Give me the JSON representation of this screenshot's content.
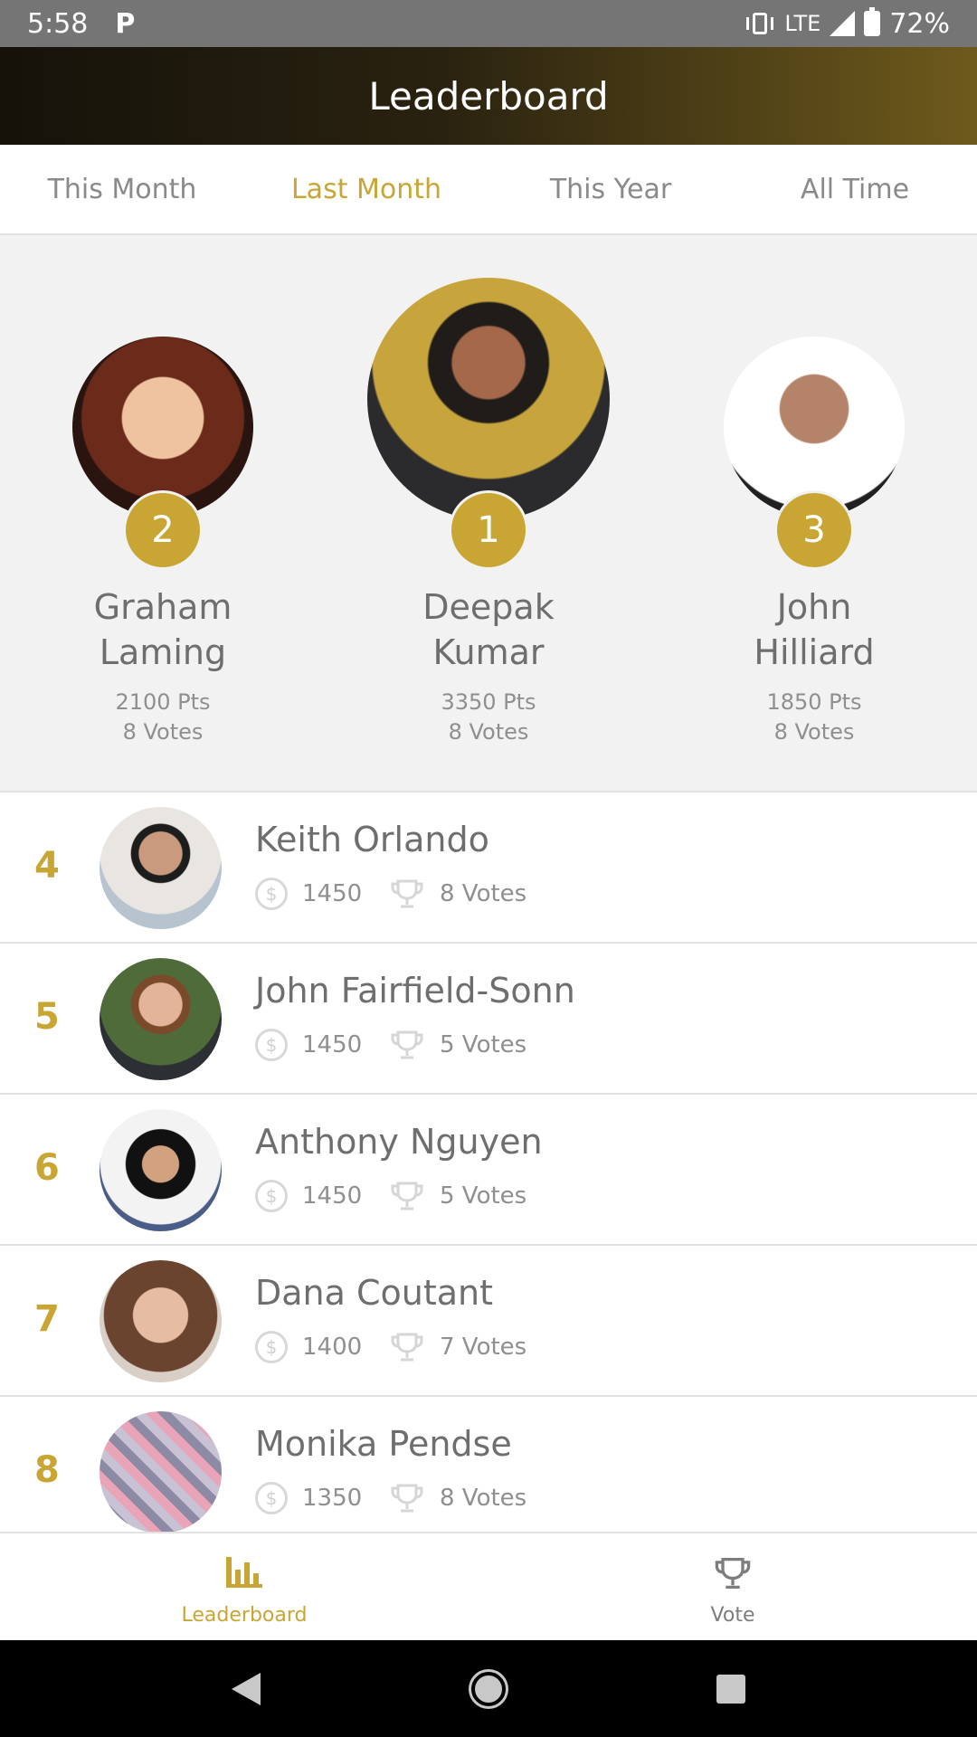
{
  "status_bar": {
    "time": "5:58",
    "network": "LTE",
    "battery": "72%"
  },
  "header": {
    "title": "Leaderboard"
  },
  "tabs": [
    {
      "label": "This Month",
      "active": false
    },
    {
      "label": "Last Month",
      "active": true
    },
    {
      "label": "This Year",
      "active": false
    },
    {
      "label": "All Time",
      "active": false
    }
  ],
  "podium": {
    "second": {
      "rank": "2",
      "first": "Graham",
      "last": "Laming",
      "points": "2100 Pts",
      "votes": "8 Votes"
    },
    "first": {
      "rank": "1",
      "first": "Deepak",
      "last": "Kumar",
      "points": "3350 Pts",
      "votes": "8 Votes"
    },
    "third": {
      "rank": "3",
      "first": "John",
      "last": "Hilliard",
      "points": "1850 Pts",
      "votes": "8 Votes"
    }
  },
  "list": [
    {
      "rank": "4",
      "name": "Keith Orlando",
      "points": "1450",
      "votes": "8 Votes"
    },
    {
      "rank": "5",
      "name": "John Fairfield-Sonn",
      "points": "1450",
      "votes": "5 Votes"
    },
    {
      "rank": "6",
      "name": "Anthony Nguyen",
      "points": "1450",
      "votes": "5 Votes"
    },
    {
      "rank": "7",
      "name": "Dana Coutant",
      "points": "1400",
      "votes": "7 Votes"
    },
    {
      "rank": "8",
      "name": "Monika Pendse",
      "points": "1350",
      "votes": "8 Votes"
    }
  ],
  "bottom_nav": [
    {
      "label": "Leaderboard",
      "icon": "bar-chart-icon",
      "active": true
    },
    {
      "label": "Vote",
      "icon": "trophy-icon",
      "active": false
    }
  ],
  "colors": {
    "accent": "#c9a634",
    "text": "#6e6e6e",
    "muted": "#8f8f8f"
  }
}
